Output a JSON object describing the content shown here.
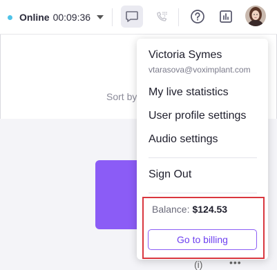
{
  "topbar": {
    "status_label": "Online",
    "status_timer": "00:09:36",
    "status_color": "#4fc3e8",
    "icons": {
      "chat": "chat-bubble-icon",
      "phone": "phone-keypad-icon",
      "help": "help-circle-icon",
      "stats": "bar-chart-icon"
    }
  },
  "background": {
    "sort_text": "Sort by",
    "accent_color": "#8b5cf6"
  },
  "menu": {
    "user_name": "Victoria Symes",
    "user_email": "vtarasova@voximplant.com",
    "items": [
      "My live statistics",
      "User profile settings",
      "Audio settings"
    ],
    "sign_out": "Sign Out",
    "balance_label": "Balance:",
    "balance_amount": "$124.53",
    "billing_button": "Go to billing"
  }
}
